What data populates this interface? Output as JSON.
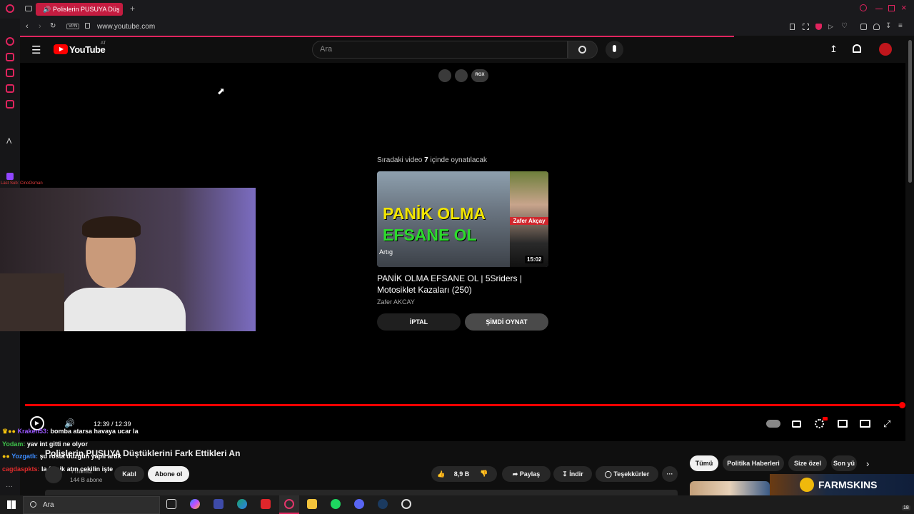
{
  "browser": {
    "tab_title": "Polislerin PUSUYA Düş",
    "url": "www.youtube.com",
    "vpn_label": "VPN"
  },
  "youtube": {
    "logo_text": "YouTube",
    "logo_region": "AT",
    "search_placeholder": "Ara"
  },
  "overlay_buttons": {
    "rgx_label": "RGX"
  },
  "up_next": {
    "heading_prefix": "Sıradaki video",
    "countdown": "7",
    "heading_suffix": "içinde oynatılacak",
    "thumb_line1": "PANİK OLMA",
    "thumb_line2": "EFSANE OL",
    "thumb_badge": "Zafer Akçay",
    "thumb_corner": "Artıg",
    "duration": "15:02",
    "title": "PANİK OLMA EFSANE OL | 5Sriders | Motosiklet Kazaları (250)",
    "channel": "Zafer AKCAY",
    "cancel_label": "İPTAL",
    "play_now_label": "ŞİMDİ OYNAT"
  },
  "player": {
    "time": "12:39 / 12:39",
    "progress": 1.0
  },
  "stream_overlay": {
    "last_sub": "Last Sub: CinoOsman"
  },
  "chat": [
    {
      "user": "Kraken53:",
      "message": "bomba atarsa havaya ucar la",
      "color": "#9b59ff"
    },
    {
      "user": "Yodam:",
      "message": "yav int gitti ne olyor",
      "color": "#3ec24a"
    },
    {
      "user": "Yozgatlı:",
      "message": "şu rosta düzgün yapıl artık",
      "color": "#3c8cff"
    },
    {
      "user": "cagdaspkts:",
      "message": "la flasik atın çekilin işte",
      "color": "#e02b2b"
    }
  ],
  "video": {
    "title": "Polislerin PUSUYA Düştüklerini Fark Ettikleri An",
    "channel": "Yılmaz",
    "subscribers": "144 B abone",
    "join_label": "Katıl",
    "subscribe_label": "Abone ol",
    "likes": "8,9 B",
    "share_label": "Paylaş",
    "download_label": "İndir",
    "thanks_label": "Teşekkürler"
  },
  "chips": [
    "Tümü",
    "Politika Haberleri",
    "Size özel",
    "Son yü"
  ],
  "ad": {
    "brand": "FARMSKINS"
  },
  "taskbar": {
    "search_placeholder": "Ara",
    "tray_badge": "18"
  },
  "colors": {
    "youtube_red": "#ff0000",
    "opera_accent": "#e0245e"
  }
}
